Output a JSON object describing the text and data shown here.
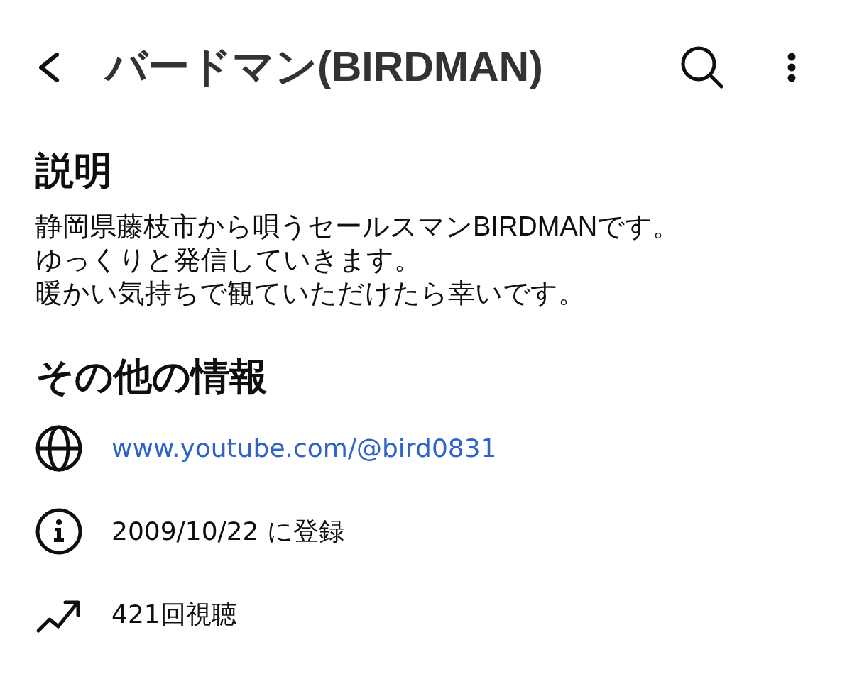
{
  "header": {
    "title": "バードマン(BIRDMAN)"
  },
  "description": {
    "heading": "説明",
    "lines": [
      "静岡県藤枝市から唄うセールスマンBIRDMANです。",
      "ゆっくりと発信していきます。",
      "暖かい気持ちで観ていただけたら幸いです。"
    ]
  },
  "more_info": {
    "heading": "その他の情報",
    "items": [
      {
        "kind": "link",
        "text": "www.youtube.com/@bird0831"
      },
      {
        "kind": "joined",
        "text": "2009/10/22 に登録"
      },
      {
        "kind": "views",
        "text": "421回視聴"
      }
    ]
  }
}
